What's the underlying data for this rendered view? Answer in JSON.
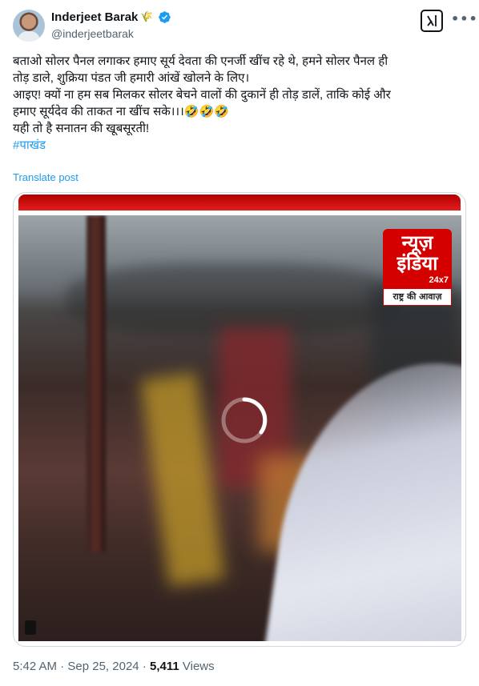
{
  "author": {
    "display_name": "Inderjeet Barak",
    "handle": "@inderjeetbarak",
    "badge_emoji": "🌾",
    "verified": true,
    "avatar_icon": "profile-photo"
  },
  "header_actions": {
    "grok_icon": "grok-icon",
    "more_icon": "more-icon",
    "more_label": "•••"
  },
  "tweet": {
    "lines": [
      "बताओ सोलर पैनल लगाकर हमाए सूर्य देवता की एनर्जी खींच रहे थे, हमने सोलर पैनल ही",
      "तोड़ डाले, शुक्रिया पंडत जी हमारी आंखें खोलने के लिए।",
      "आइए! क्यों ना हम सब मिलकर सोलर बेचने वालों की दुकानें ही तोड़ डालें, ताकि कोई और",
      "हमाए सूर्यदेव की ताकत ना खींच सके।।।🤣🤣🤣",
      "यही तो है सनातन की खूबसूरती!"
    ],
    "hashtag": "#पाखंड",
    "translate_label": "Translate post"
  },
  "media": {
    "logo_line1": "न्यूज़",
    "logo_line2": "इंडिया",
    "logo_sub": "24x7",
    "logo_tag": "राष्ट्र की आवाज़",
    "state": "loading"
  },
  "meta": {
    "time": "5:42 AM",
    "separator": "·",
    "date": "Sep 25, 2024",
    "views_count": "5,411",
    "views_label": "Views"
  },
  "colors": {
    "link": "#1d9bf0",
    "secondary_text": "#536471",
    "primary_text": "#0f1419",
    "verified": "#1d9bf0",
    "news_red": "#d40000"
  }
}
